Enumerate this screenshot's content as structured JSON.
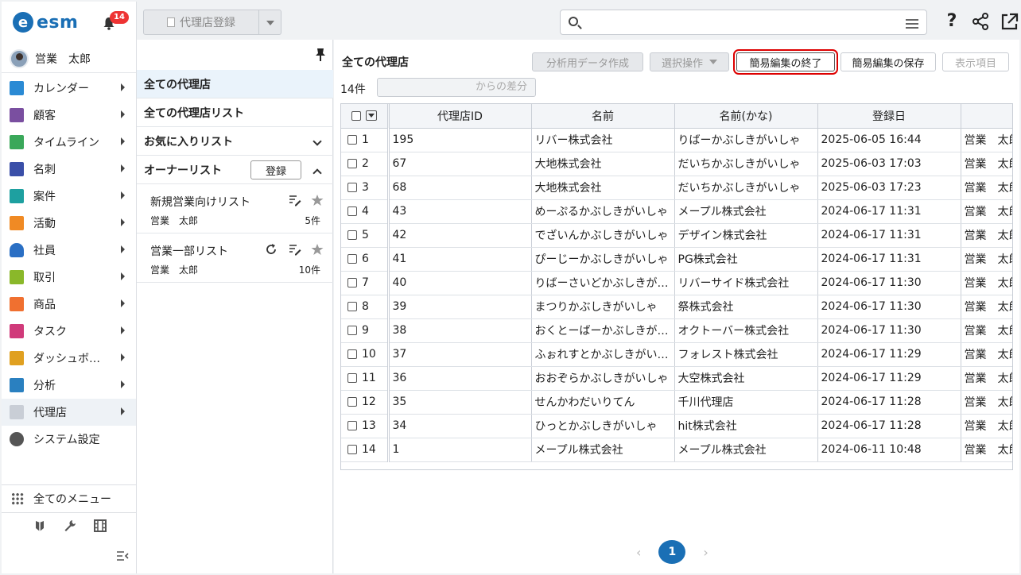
{
  "app": {
    "logo_text": "esm",
    "logo_mark": "e",
    "notification_count": "14",
    "user_name": "営業　太郎"
  },
  "nav": {
    "items": [
      {
        "label": "カレンダー",
        "icon": "calendar-icon",
        "color": "#2a8ad4"
      },
      {
        "label": "顧客",
        "icon": "building-icon",
        "color": "#7a4fa0"
      },
      {
        "label": "タイムライン",
        "icon": "chat-icon",
        "color": "#3aa85a"
      },
      {
        "label": "名刺",
        "icon": "business-card-icon",
        "color": "#3a4fa8"
      },
      {
        "label": "案件",
        "icon": "folder-icon",
        "color": "#1ea0a0"
      },
      {
        "label": "活動",
        "icon": "clipboard-icon",
        "color": "#f08a24"
      },
      {
        "label": "社員",
        "icon": "person-icon",
        "color": "#2a6fc4"
      },
      {
        "label": "取引",
        "icon": "deal-icon",
        "color": "#8ab82a"
      },
      {
        "label": "商品",
        "icon": "box-icon",
        "color": "#f07030"
      },
      {
        "label": "タスク",
        "icon": "task-check-icon",
        "color": "#d03a7a"
      },
      {
        "label": "ダッシュボ…",
        "icon": "dashboard-icon",
        "color": "#e0a020"
      },
      {
        "label": "分析",
        "icon": "chart-icon",
        "color": "#2a80c0"
      },
      {
        "label": "代理店",
        "icon": "agency-doc-icon",
        "color": "#c9ced6"
      },
      {
        "label": "システム設定",
        "icon": "gear-icon",
        "color": "#555555"
      }
    ],
    "all_menu_label": "全てのメニュー"
  },
  "topbar": {
    "register_label": "代理店登録"
  },
  "list_panel": {
    "rows": [
      {
        "label": "全ての代理店"
      },
      {
        "label": "全ての代理店リスト"
      },
      {
        "label": "お気に入りリスト"
      },
      {
        "label": "オーナーリスト"
      }
    ],
    "register_button": "登録",
    "owner_lists": [
      {
        "name": "新規営業向けリスト",
        "owner": "営業　太郎",
        "count": "5件"
      },
      {
        "name": "営業一部リスト",
        "owner": "営業　太郎",
        "count": "10件"
      }
    ]
  },
  "main": {
    "title": "全ての代理店",
    "buttons": {
      "analysis": "分析用データ作成",
      "select_op": "選択操作",
      "end_quick_edit": "簡易編集の終了",
      "save_quick_edit": "簡易編集の保存",
      "display_items": "表示項目"
    },
    "count": "14件",
    "diff_placeholder": "からの差分",
    "columns": [
      "代理店ID",
      "名前",
      "名前(かな)",
      "登録日",
      ""
    ],
    "rows": [
      {
        "no": "1",
        "id": "195",
        "name": "リバー株式会社",
        "kana": "りばーかぶしきがいしゃ",
        "date": "2025-06-05 16:44",
        "owner": "営業　太郎"
      },
      {
        "no": "2",
        "id": "67",
        "name": "大地株式会社",
        "kana": "だいちかぶしきがいしゃ",
        "date": "2025-06-03 17:03",
        "owner": "営業　太郎"
      },
      {
        "no": "3",
        "id": "68",
        "name": "大地株式会社",
        "kana": "だいちかぶしきがいしゃ",
        "date": "2025-06-03 17:23",
        "owner": "営業　太郎"
      },
      {
        "no": "4",
        "id": "43",
        "name": "めーぷるかぶしきがいしゃ",
        "kana": "メープル株式会社",
        "date": "2024-06-17 11:31",
        "owner": "営業　太郎"
      },
      {
        "no": "5",
        "id": "42",
        "name": "でざいんかぶしきがいしゃ",
        "kana": "デザイン株式会社",
        "date": "2024-06-17 11:31",
        "owner": "営業　太郎"
      },
      {
        "no": "6",
        "id": "41",
        "name": "ぴーじーかぶしきがいしゃ",
        "kana": "PG株式会社",
        "date": "2024-06-17 11:31",
        "owner": "営業　太郎"
      },
      {
        "no": "7",
        "id": "40",
        "name": "りばーさいどかぶしきが…",
        "kana": "リバーサイド株式会社",
        "date": "2024-06-17 11:30",
        "owner": "営業　太郎"
      },
      {
        "no": "8",
        "id": "39",
        "name": "まつりかぶしきがいしゃ",
        "kana": "祭株式会社",
        "date": "2024-06-17 11:30",
        "owner": "営業　太郎"
      },
      {
        "no": "9",
        "id": "38",
        "name": "おくとーばーかぶしきが…",
        "kana": "オクトーバー株式会社",
        "date": "2024-06-17 11:30",
        "owner": "営業　太郎"
      },
      {
        "no": "10",
        "id": "37",
        "name": "ふぉれすとかぶしきがい…",
        "kana": "フォレスト株式会社",
        "date": "2024-06-17 11:29",
        "owner": "営業　太郎"
      },
      {
        "no": "11",
        "id": "36",
        "name": "おおぞらかぶしきがいしゃ",
        "kana": "大空株式会社",
        "date": "2024-06-17 11:29",
        "owner": "営業　太郎"
      },
      {
        "no": "12",
        "id": "35",
        "name": "せんかわだいりてん",
        "kana": "千川代理店",
        "date": "2024-06-17 11:28",
        "owner": "営業　太郎"
      },
      {
        "no": "13",
        "id": "34",
        "name": "ひっとかぶしきがいしゃ",
        "kana": "hit株式会社",
        "date": "2024-06-17 11:28",
        "owner": "営業　太郎"
      },
      {
        "no": "14",
        "id": "1",
        "name": "メープル株式会社",
        "kana": "メープル株式会社",
        "date": "2024-06-11 10:48",
        "owner": "営業　太郎"
      }
    ],
    "pager": {
      "current": "1"
    }
  }
}
